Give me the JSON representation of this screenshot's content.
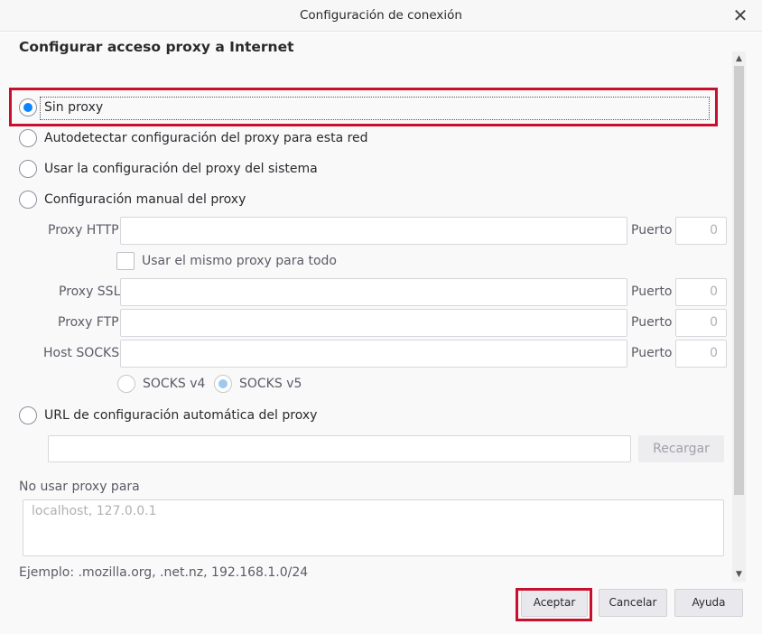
{
  "window": {
    "title": "Configuración de conexión",
    "close_glyph": "✕"
  },
  "section_title": "Configurar acceso proxy a Internet",
  "options": {
    "no_proxy": "Sin proxy",
    "auto_detect": "Autodetectar configuración del proxy para esta red",
    "system": "Usar la configuración del proxy del sistema",
    "manual": "Configuración manual del proxy",
    "auto_url": "URL de configuración automática del proxy"
  },
  "selected_option": "no_proxy",
  "manual": {
    "http_label": "Proxy HTTP",
    "port_label": "Puerto",
    "same_proxy_label": "Usar el mismo proxy para todo",
    "ssl_label": "Proxy SSL",
    "ftp_label": "Proxy FTP",
    "socks_label": "Host SOCKS",
    "http_port": "0",
    "ssl_port": "0",
    "ftp_port": "0",
    "socks_port": "0",
    "socks_v4": "SOCKS v4",
    "socks_v5": "SOCKS v5",
    "socks_selected": "v5"
  },
  "reload_label": "Recargar",
  "no_proxy_for": {
    "label": "No usar proxy para",
    "placeholder": "localhost, 127.0.0.1",
    "example": "Ejemplo: .mozilla.org, .net.nz, 192.168.1.0/24"
  },
  "buttons": {
    "ok": "Aceptar",
    "cancel": "Cancelar",
    "help": "Ayuda"
  },
  "colors": {
    "accent": "#0a84ff",
    "highlight": "#c8102e"
  },
  "icons": {
    "close": "close-icon",
    "scroll_up": "chevron-up-icon",
    "scroll_down": "chevron-down-icon"
  },
  "scroll_glyphs": {
    "up": "▲",
    "down": "▼"
  }
}
